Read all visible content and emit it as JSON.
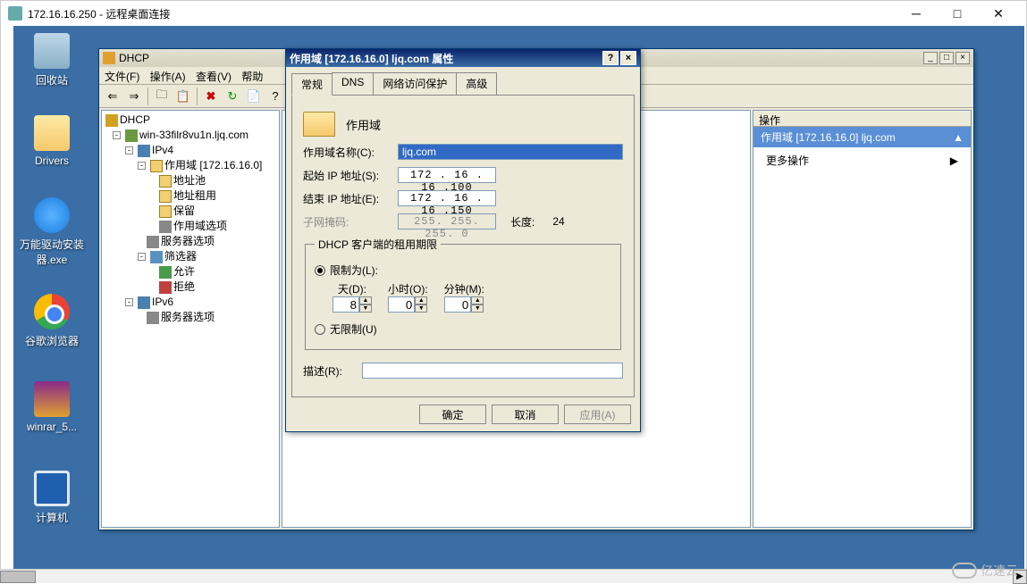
{
  "win10": {
    "title": "172.16.16.250 - 远程桌面连接"
  },
  "desktop": {
    "recycle": "回收站",
    "drivers": "Drivers",
    "gear": "万能驱动安装器.exe",
    "chrome": "谷歌浏览器",
    "winrar": "winrar_5...",
    "computer": "计算机"
  },
  "mmc": {
    "title": "DHCP",
    "menu": {
      "file": "文件(F)",
      "action": "操作(A)",
      "view": "查看(V)",
      "help": "帮助"
    },
    "tree": {
      "root": "DHCP",
      "server": "win-33filr8vu1n.ljq.com",
      "ipv4": "IPv4",
      "scope": "作用域 [172.16.16.0]",
      "pool": "地址池",
      "lease": "地址租用",
      "reserve": "保留",
      "scopeopt": "作用域选项",
      "srvopt": "服务器选项",
      "filter": "筛选器",
      "allow": "允许",
      "deny": "拒绝",
      "ipv6": "IPv6",
      "srvopt6": "服务器选项"
    },
    "actions": {
      "header": "操作",
      "section": "作用域 [172.16.16.0] ljq.com",
      "more": "更多操作"
    }
  },
  "dlg": {
    "title": "作用域 [172.16.16.0] ljq.com 属性",
    "tabs": {
      "general": "常规",
      "dns": "DNS",
      "nap": "网络访问保护",
      "adv": "高级"
    },
    "heading": "作用域",
    "labels": {
      "name": "作用域名称(C):",
      "start": "起始 IP 地址(S):",
      "end": "结束 IP 地址(E):",
      "mask": "子网掩码:",
      "length": "长度:",
      "desc": "描述(R):"
    },
    "values": {
      "name": "ljq.com",
      "start": "172 . 16 . 16 .100",
      "end": "172 . 16 . 16 .150",
      "mask": "255. 255. 255.  0",
      "length": "24",
      "desc": ""
    },
    "lease": {
      "legend": "DHCP 客户端的租用期限",
      "limited": "限制为(L):",
      "days_l": "天(D):",
      "hours_l": "小时(O):",
      "mins_l": "分钟(M):",
      "days": "8",
      "hours": "0",
      "mins": "0",
      "unlimited": "无限制(U)"
    },
    "buttons": {
      "ok": "确定",
      "cancel": "取消",
      "apply": "应用(A)"
    }
  },
  "watermark": "亿速云"
}
